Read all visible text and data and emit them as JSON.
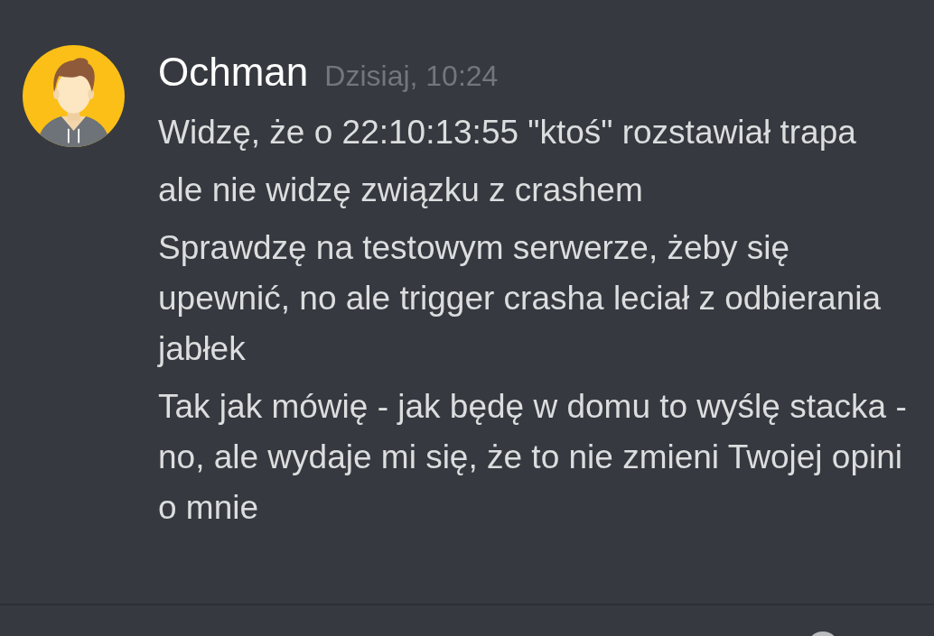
{
  "message": {
    "author": "Ochman",
    "timestamp": "Dzisiaj, 10:24",
    "paragraphs": [
      [
        "Widzę, że o 22:10:13:55 \"ktoś\" rozstawiał trapa"
      ],
      [
        "ale nie widzę związku z crashem"
      ],
      [
        "Sprawdzę na testowym serwerze, żeby się",
        "upewnić, no ale trigger crasha leciał z odbierania",
        "jabłek"
      ],
      [
        "Tak jak mówię - jak będę w domu to wyślę stacka -",
        "no, ale wydaje mi się, że to nie zmieni Twojej opini",
        "o mnie"
      ]
    ]
  }
}
